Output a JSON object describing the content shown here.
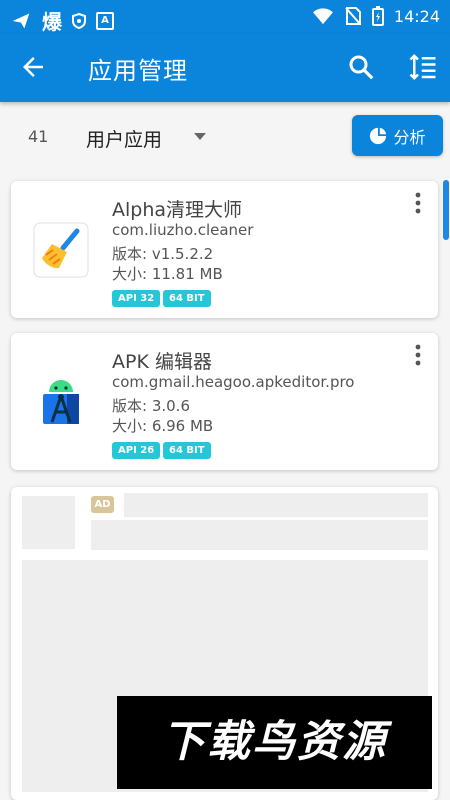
{
  "status_bar": {
    "left_icons": [
      "send-icon",
      "bao-badge-icon",
      "shield-icon",
      "a-box-icon"
    ],
    "bao_label": "爆",
    "a_label": "A",
    "time": "14:24",
    "right_icons": [
      "wifi-icon",
      "no-sim-icon",
      "battery-icon"
    ]
  },
  "app_bar": {
    "title": "应用管理",
    "icons": [
      "back-arrow-icon",
      "search-icon",
      "sort-icon"
    ]
  },
  "filter": {
    "count": "41",
    "type_label": "用户应用",
    "analyze_label": "分析",
    "analyze_icon": "pie-chart-icon"
  },
  "apps": [
    {
      "name": "Alpha清理大师",
      "package": "com.liuzho.cleaner",
      "version": "版本: v1.5.2.2",
      "size": "大小: 11.81 MB",
      "badges": [
        "API 32",
        "64 BIT"
      ],
      "icon": "broom-icon"
    },
    {
      "name": "APK 编辑器",
      "package": "com.gmail.heagoo.apkeditor.pro",
      "version": "版本: 3.0.6",
      "size": "大小: 6.96 MB",
      "badges": [
        "API 26",
        "64 BIT"
      ],
      "icon": "android-compass-icon"
    }
  ],
  "ad": {
    "tag": "AD"
  },
  "watermark": "下载鸟资源",
  "colors": {
    "primary": "#0a85db",
    "badge": "#26c6da",
    "ad_tag": "#d8c69a"
  }
}
